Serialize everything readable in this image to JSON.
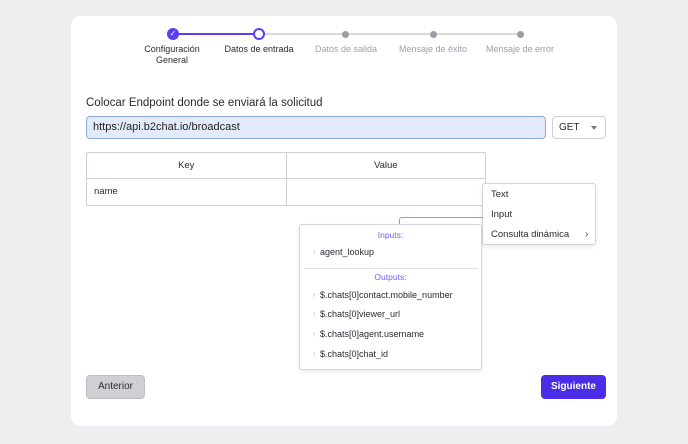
{
  "stepper": {
    "steps": [
      {
        "label": "Configuración\nGeneral",
        "state": "done"
      },
      {
        "label": "Datos de entrada",
        "state": "current"
      },
      {
        "label": "Datos de salida",
        "state": "pending"
      },
      {
        "label": "Mensaje de éxito",
        "state": "pending"
      },
      {
        "label": "Mensaje de error",
        "state": "pending"
      }
    ],
    "check_glyph": "✓"
  },
  "form": {
    "title": "Colocar Endpoint donde se enviará la solicitud",
    "url_value": "https://api.b2chat.io/broadcast",
    "method": "GET"
  },
  "table": {
    "headers": [
      "Key",
      "Value"
    ],
    "rows": [
      [
        "name",
        ""
      ]
    ]
  },
  "type_menu": {
    "items": [
      "Text",
      "Input",
      "Consulta dinámica"
    ],
    "submenu_glyph": "›"
  },
  "variables_menu": {
    "inputs_header": "Inputs:",
    "inputs": [
      "agent_lookup"
    ],
    "outputs_header": "Outputs:",
    "outputs": [
      "$.chats[0]contact.mobile_number",
      "$.chats[0]viewer_url",
      "$.chats[0]agent.username",
      "$.chats[0]chat_id"
    ],
    "item_icon": "↑"
  },
  "buttons": {
    "prev": "Anterior",
    "next": "Siguiente"
  },
  "colors": {
    "accent": "#4b2de8",
    "step_active": "#5b3df5",
    "variables_header": "#7a5cf0"
  }
}
